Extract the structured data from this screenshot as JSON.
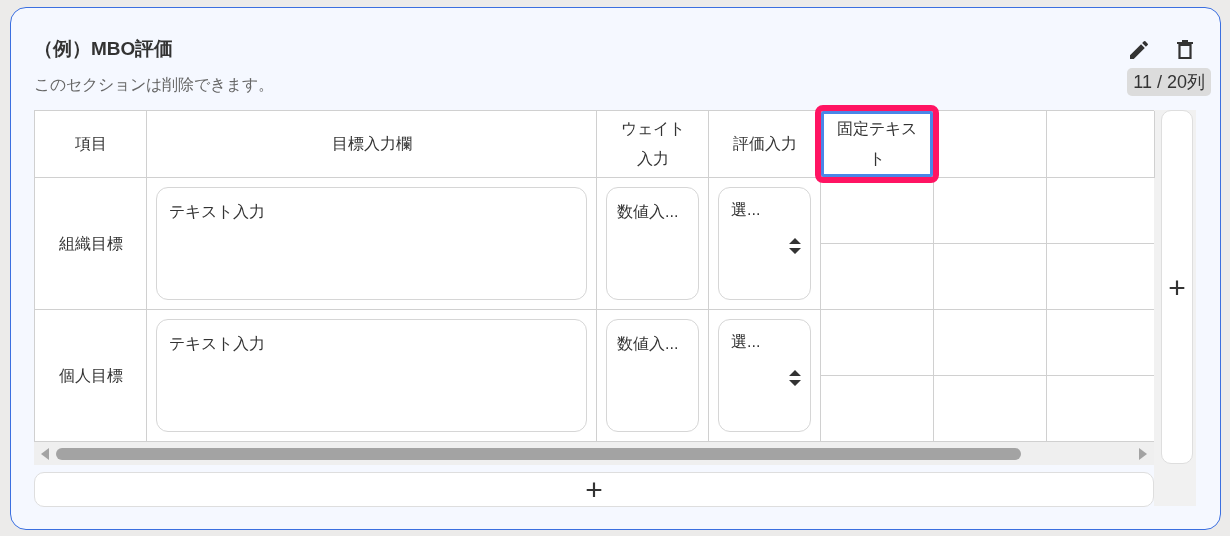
{
  "section": {
    "title": "（例）MBO評価",
    "description": "このセクションは削除できます。",
    "column_count": "11 / 20列"
  },
  "table": {
    "columns": [
      {
        "kind": "header",
        "label": "項目",
        "selected": false
      },
      {
        "kind": "header",
        "label": "目標入力欄",
        "selected": false
      },
      {
        "kind": "header",
        "label": "ウェイト入力",
        "selected": false
      },
      {
        "kind": "header",
        "label": "評価入力",
        "selected": false
      },
      {
        "kind": "header",
        "label": "固定テキスト",
        "selected": true
      },
      {
        "kind": "empty"
      },
      {
        "kind": "empty"
      }
    ],
    "rows": [
      {
        "cells": [
          {
            "kind": "label",
            "text": "組織目標"
          },
          {
            "kind": "textarea",
            "placeholder": "テキスト入力"
          },
          {
            "kind": "number",
            "placeholder": "数値入..."
          },
          {
            "kind": "select",
            "value": "選..."
          }
        ]
      },
      {
        "cells": [
          {
            "kind": "label",
            "text": "個人目標"
          },
          {
            "kind": "textarea",
            "placeholder": "テキスト入力"
          },
          {
            "kind": "number",
            "placeholder": "数値入..."
          },
          {
            "kind": "select",
            "value": "選..."
          }
        ]
      }
    ]
  },
  "add_row_button": "+",
  "add_column_button": "+"
}
